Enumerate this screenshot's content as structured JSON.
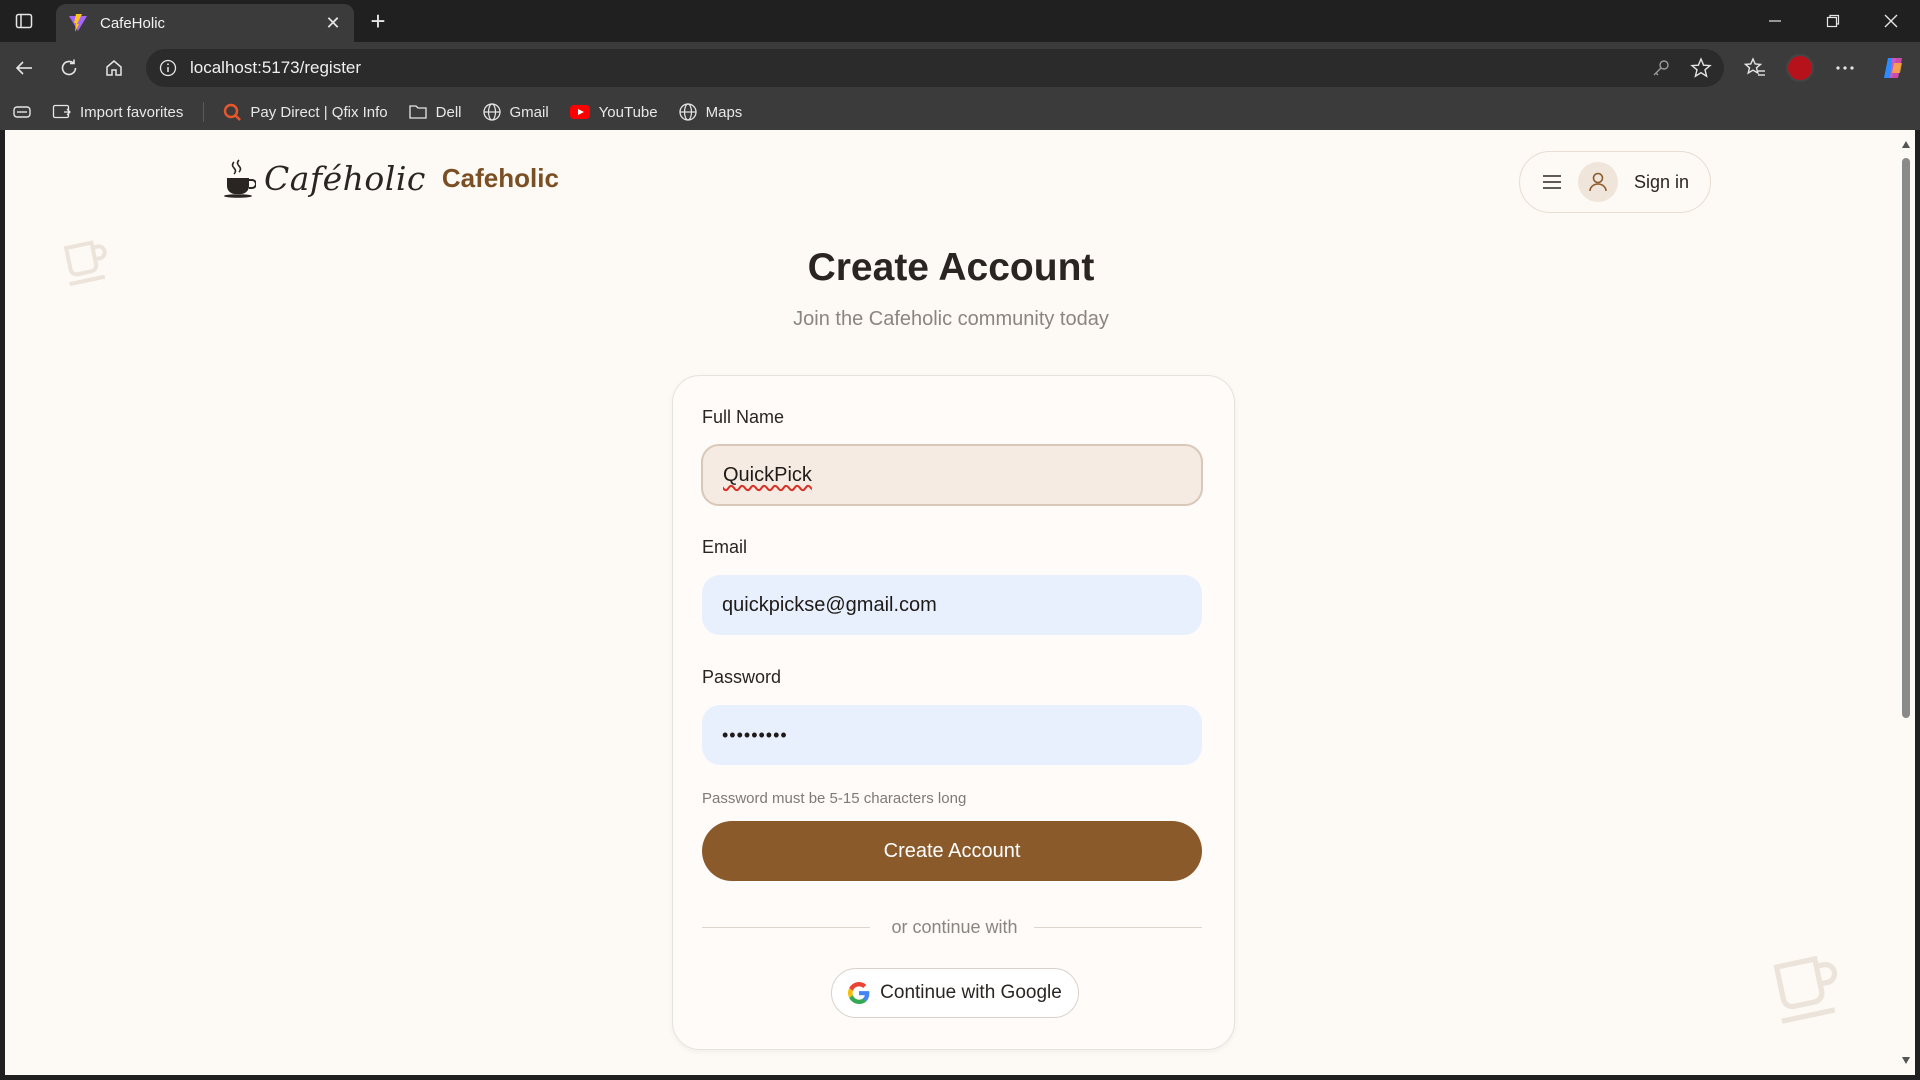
{
  "browser": {
    "tab_title": "CafeHolic",
    "url": "localhost:5173/register",
    "bookmarks": [
      {
        "label": "Import favorites",
        "icon": "import-icon"
      },
      {
        "label": "Pay Direct | Qfix Info",
        "icon": "qfix-icon"
      },
      {
        "label": "Dell",
        "icon": "folder-icon"
      },
      {
        "label": "Gmail",
        "icon": "globe-icon"
      },
      {
        "label": "YouTube",
        "icon": "youtube-icon"
      },
      {
        "label": "Maps",
        "icon": "globe-icon"
      }
    ],
    "profile_color": "#b5121b"
  },
  "header": {
    "logo_script": "Caféholic",
    "brand_name": "Cafeholic",
    "signin_label": "Sign in"
  },
  "page": {
    "title": "Create Account",
    "subtitle": "Join the Cafeholic community today"
  },
  "form": {
    "name_label": "Full Name",
    "name_value": "QuickPick",
    "email_label": "Email",
    "email_value": "quickpickse@gmail.com",
    "password_label": "Password",
    "password_value": "•••••••••",
    "password_hint": "Password must be 5-15 characters long",
    "submit_label": "Create Account",
    "divider_text": "or continue with",
    "google_label": "Continue with Google"
  },
  "colors": {
    "accent": "#8b5a2b",
    "brand_text": "#7b4f24",
    "page_bg": "#fdf9f4",
    "autofill_bg": "#e8f0fe"
  }
}
